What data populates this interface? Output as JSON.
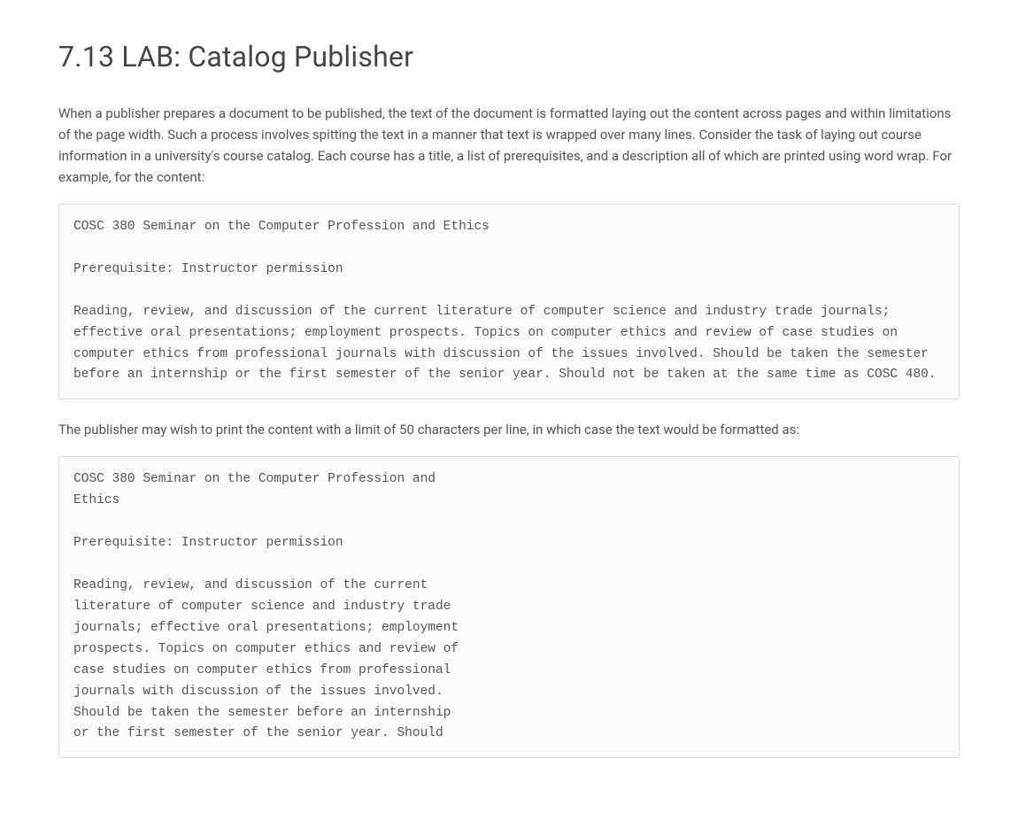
{
  "title": "7.13 LAB: Catalog Publisher",
  "intro": "When a publisher prepares a document to be published, the text of the document is formatted laying out the content across pages and within limitations of the page width. Such a process involves spitting the text in a manner that text is wrapped over many lines. Consider the task of laying out course information in a university's course catalog. Each course has a title, a list of prerequisites, and a description all of which are printed using word wrap. For example, for the content:",
  "code_block_1": "COSC 380 Seminar on the Computer Profession and Ethics\n\nPrerequisite: Instructor permission\n\nReading, review, and discussion of the current literature of computer science and industry trade journals; effective oral presentations; employment prospects. Topics on computer ethics and review of case studies on computer ethics from professional journals with discussion of the issues involved. Should be taken the semester before an internship or the first semester of the senior year. Should not be taken at the same time as COSC 480.",
  "middle_text": "The publisher may wish to print the content with a limit of 50 characters per line, in which case the text would be formatted as:",
  "code_block_2": "COSC 380 Seminar on the Computer Profession and\nEthics\n\nPrerequisite: Instructor permission\n\nReading, review, and discussion of the current\nliterature of computer science and industry trade\njournals; effective oral presentations; employment\nprospects. Topics on computer ethics and review of\ncase studies on computer ethics from professional\njournals with discussion of the issues involved.\nShould be taken the semester before an internship\nor the first semester of the senior year. Should"
}
